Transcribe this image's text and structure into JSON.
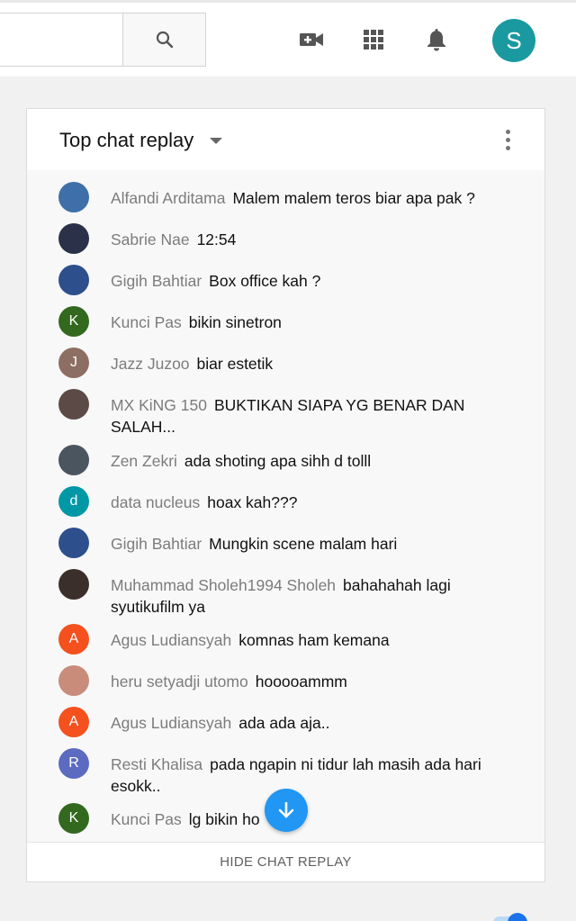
{
  "topbar": {
    "search_placeholder": "",
    "icons": [
      "search-icon",
      "video-camera-plus-icon",
      "apps-grid-icon",
      "bell-icon"
    ],
    "avatar_letter": "S",
    "avatar_color": "#1a9aa0"
  },
  "chat": {
    "title": "Top chat replay",
    "hide_label": "HIDE CHAT REPLAY",
    "messages": [
      {
        "author": "Alfandi Arditama",
        "text": "Malem malem teros biar apa pak ?",
        "avatar": "",
        "color": "#3f6fa8"
      },
      {
        "author": "Sabrie Nae",
        "text": "12:54",
        "avatar": "",
        "color": "#2a3148"
      },
      {
        "author": "Gigih Bahtiar",
        "text": "Box office kah ?",
        "avatar": "",
        "color": "#2d4f8c"
      },
      {
        "author": "Kunci Pas",
        "text": "bikin sinetron",
        "avatar": "K",
        "color": "#33691e"
      },
      {
        "author": "Jazz Juzoo",
        "text": "biar estetik",
        "avatar": "J",
        "color": "#8d6e63"
      },
      {
        "author": "MX KiNG 150",
        "text": "BUKTIKAN SIAPA YG BENAR DAN SALAH...",
        "avatar": "",
        "color": "#5b4a45"
      },
      {
        "author": "Zen Zekri",
        "text": "ada shoting apa sihh d tolll",
        "avatar": "",
        "color": "#4a5560"
      },
      {
        "author": "data nucleus",
        "text": "hoax kah???",
        "avatar": "d",
        "color": "#0097a7"
      },
      {
        "author": "Gigih Bahtiar",
        "text": "Mungkin scene malam hari",
        "avatar": "",
        "color": "#2d4f8c"
      },
      {
        "author": "Muhammad Sholeh1994 Sholeh",
        "text": "bahahahah lagi syutikufilm ya",
        "avatar": "",
        "color": "#3a2f2a"
      },
      {
        "author": "Agus Ludiansyah",
        "text": "komnas ham kemana",
        "avatar": "A",
        "color": "#f4511e"
      },
      {
        "author": "heru setyadji utomo",
        "text": "hooooammm",
        "avatar": "",
        "color": "#c98b7a"
      },
      {
        "author": "Agus Ludiansyah",
        "text": "ada ada aja..",
        "avatar": "A",
        "color": "#f4511e"
      },
      {
        "author": "Resti Khalisa",
        "text": "pada ngapin ni tidur lah masih ada hari esokk..",
        "avatar": "R",
        "color": "#5c6bc0"
      },
      {
        "author": "Kunci Pas",
        "text": "lg bikin ho",
        "avatar": "K",
        "color": "#33691e"
      }
    ]
  },
  "accent_color": "#2196f3"
}
